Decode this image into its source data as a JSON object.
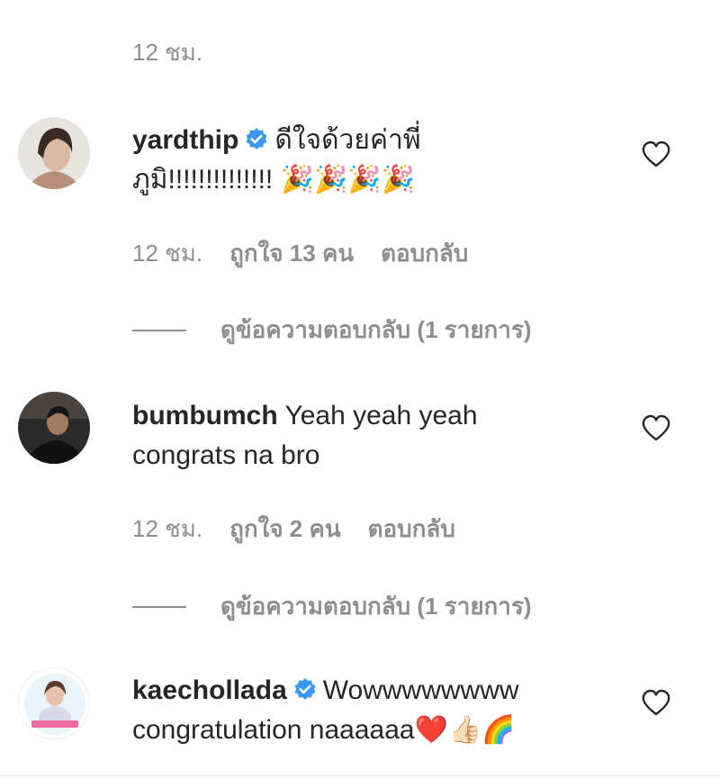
{
  "top_meta": {
    "time": "12 ชม."
  },
  "comments": [
    {
      "username": "yardthip",
      "verified": true,
      "text_line1": "ดีใจด้วยค่าพี่",
      "text_line2": "ภูมิ!!!!!!!!!!!!!!",
      "emojis": "🎉🎉🎉🎉",
      "time": "12 ชม.",
      "likes": "ถูกใจ 13 คน",
      "reply_label": "ตอบกลับ",
      "view_replies": "ดูข้อความตอบกลับ (1 รายการ)"
    },
    {
      "username": "bumbumch",
      "verified": false,
      "text_line1": "Yeah yeah yeah",
      "text_line2": "congrats na bro",
      "time": "12 ชม.",
      "likes": "ถูกใจ 2 คน",
      "reply_label": "ตอบกลับ",
      "view_replies": "ดูข้อความตอบกลับ (1 รายการ)"
    },
    {
      "username": "kaechollada",
      "verified": true,
      "text_line1": "Wowwwwwwww",
      "text_line2": "congratulation naaaaaa",
      "emojis": "❤️👍🏻🌈"
    }
  ],
  "colors": {
    "text": "#262626",
    "secondary": "#8e8e8e",
    "verified": "#3897f0"
  },
  "icons": {
    "verified": "verified-badge-icon",
    "like": "heart-outline-icon"
  }
}
